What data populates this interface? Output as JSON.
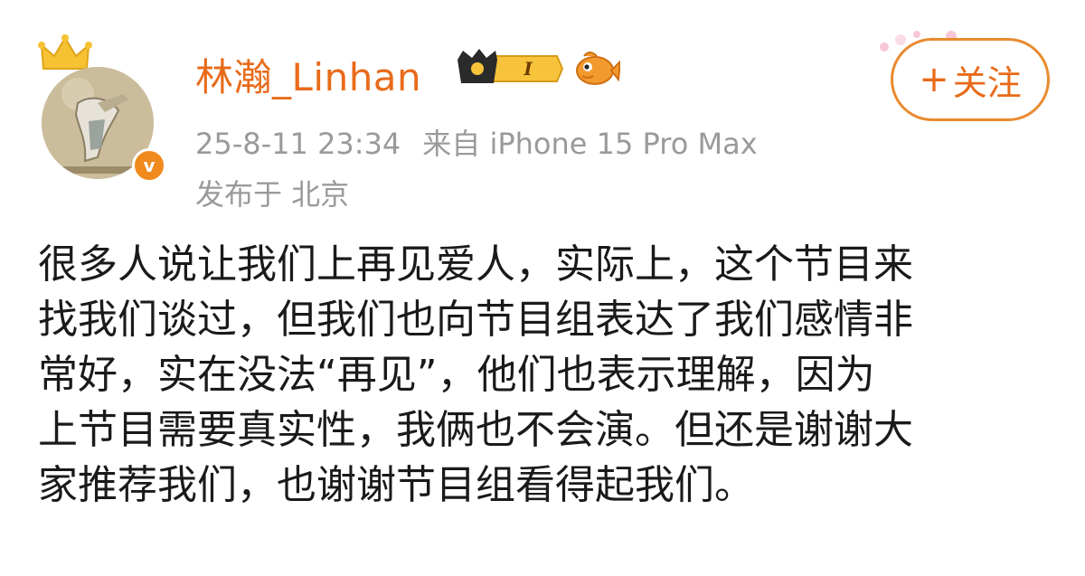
{
  "user": {
    "name": "林瀚_Linhan",
    "avatar_icon": "avatar-image",
    "crown_icon": "crown-icon",
    "verified_icon": "v",
    "level_badge": "I"
  },
  "meta": {
    "timestamp": "25-8-11 23:34",
    "source": "来自 iPhone 15 Pro Max",
    "location": "发布于 北京"
  },
  "follow": {
    "plus": "+",
    "label": "关注"
  },
  "post": {
    "lines": [
      "很多人说让我们上再见爱人，实际上，这个节目来",
      "找我们谈过，但我们也向节目组表达了我们感情非",
      "常好，实在没法“再见”，他们也表示理解，因为",
      "上节目需要真实性，我俩也不会演。但还是谢谢大",
      "家推荐我们，也谢谢节目组看得起我们。"
    ]
  },
  "colors": {
    "accent": "#e86b1a",
    "meta_text": "#9a9a9a",
    "body_text": "#1a1a1a"
  }
}
